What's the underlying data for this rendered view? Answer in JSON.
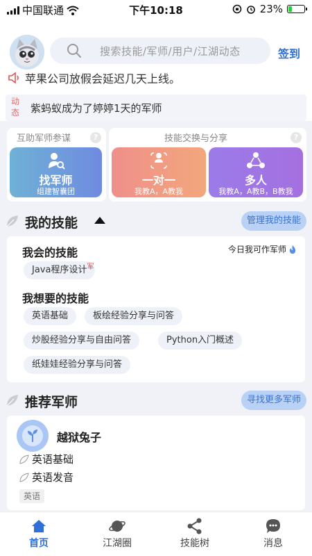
{
  "status_bar": {
    "carrier": "中国联通",
    "time": "下午10:18",
    "battery": "23%",
    "battery_level": 0.23
  },
  "header": {
    "search_placeholder": "搜索技能/军师/用户/江湖动态",
    "checkin_label": "签到",
    "notice_text": "苹果公司放假会延迟几天上线。"
  },
  "dynamic": {
    "label": "动态",
    "text": "紫蚂蚁成为了婷婷1天的军师"
  },
  "features": {
    "mentor_box_title": "互助军师参谋",
    "skill_box_title": "技能交换与分享",
    "help_symbol": "?",
    "find_mentor": {
      "title": "找军师",
      "subtitle": "组建智囊团"
    },
    "one_on_one": {
      "title": "一对一",
      "subtitle": "我教A，A教我"
    },
    "multi": {
      "title": "多人",
      "subtitle": "我教A，A教B，B教我"
    }
  },
  "my_skills": {
    "title": "我的技能",
    "manage_button": "管理我的技能",
    "known_title": "我会的技能",
    "today_mentor": "今日我可作军师",
    "known_skills": [
      {
        "label": "Java程序设计",
        "mark": "军"
      }
    ],
    "wanted_title": "我想要的技能",
    "wanted_skills": [
      "英语基础",
      "板绘经验分享与问答",
      "炒股经验分享与自由问答",
      "Python入门概述",
      "纸娃娃经验分享与问答"
    ]
  },
  "recommended": {
    "title": "推荐军师",
    "more_button": "寻找更多军师",
    "mentor": {
      "name": "越狱兔子",
      "skills": [
        "英语基础",
        "英语发音"
      ],
      "category": "英语"
    }
  },
  "tab_bar": {
    "items": [
      "首页",
      "江湖圈",
      "技能树",
      "消息"
    ],
    "active_index": 0
  },
  "colors": {
    "accent": "#2f6fd6",
    "mentor_card": "#6f9fdc",
    "one_card": "#f19a84",
    "multi_card": "#9f76e5"
  }
}
